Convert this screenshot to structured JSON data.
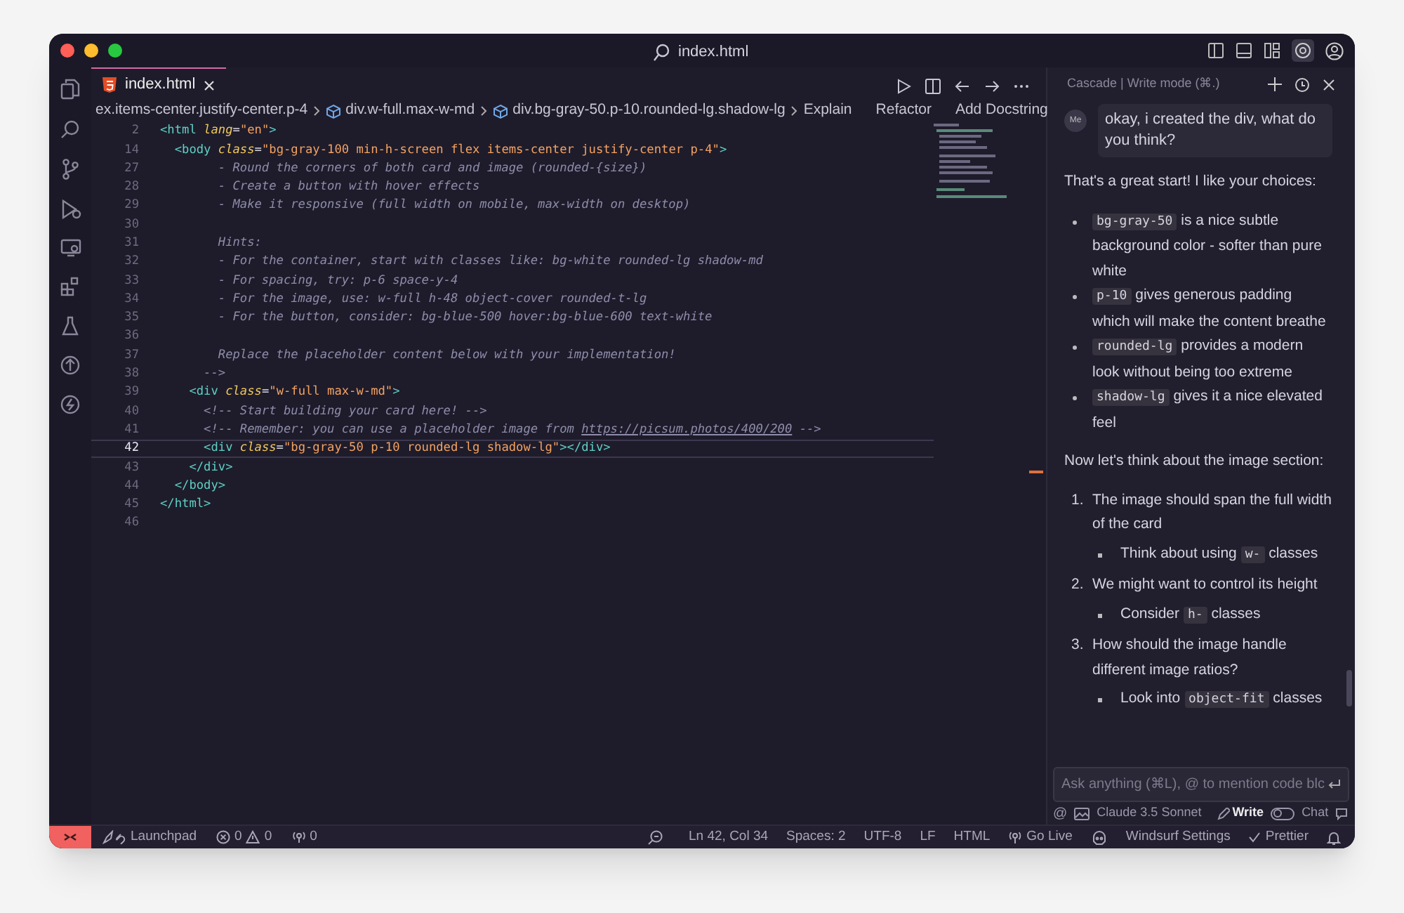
{
  "window": {
    "title": "index.html"
  },
  "activity_bar": [
    {
      "kind": "files",
      "selected": false
    },
    {
      "kind": "search",
      "selected": false
    },
    {
      "kind": "branch",
      "selected": false
    },
    {
      "kind": "run",
      "selected": false
    },
    {
      "kind": "remote",
      "selected": false
    },
    {
      "kind": "extensions",
      "selected": false
    },
    {
      "kind": "flask",
      "selected": false
    },
    {
      "kind": "deploy",
      "selected": false
    },
    {
      "kind": "bolt",
      "selected": false
    }
  ],
  "tabs": [
    {
      "label": "index.html",
      "selected": true
    }
  ],
  "breadcrumbs": [
    {
      "label": "ex.items-center.justify-center.p-4",
      "icon": false
    },
    {
      "label": "div.w-full.max-w-md",
      "icon": true
    },
    {
      "label": "div.bg-gray-50.p-10.rounded-lg.shadow-lg",
      "icon": true
    }
  ],
  "code_actions": [
    "Explain",
    "Refactor",
    "Add Docstring"
  ],
  "code_lines": [
    {
      "number": "2",
      "selected": false,
      "tokens": [
        {
          "kind": "tag",
          "text": "<html "
        },
        {
          "kind": "attr",
          "text": "lang"
        },
        {
          "kind": "punct",
          "text": "="
        },
        {
          "kind": "string",
          "text": "\"en\""
        },
        {
          "kind": "tag",
          "text": ">"
        }
      ]
    },
    {
      "number": "14",
      "selected": false,
      "tokens": [
        {
          "kind": "tag",
          "text": "  <body "
        },
        {
          "kind": "attr",
          "text": "class"
        },
        {
          "kind": "punct",
          "text": "="
        },
        {
          "kind": "string",
          "text": "\"bg-gray-100 min-h-screen flex items-center justify-center p-4\""
        },
        {
          "kind": "tag",
          "text": ">"
        }
      ]
    },
    {
      "number": "27",
      "selected": false,
      "tokens": [
        {
          "kind": "comment",
          "text": "        - Round the corners of both card and image (rounded-{size})"
        }
      ]
    },
    {
      "number": "28",
      "selected": false,
      "tokens": [
        {
          "kind": "comment",
          "text": "        - Create a button with hover effects"
        }
      ]
    },
    {
      "number": "29",
      "selected": false,
      "tokens": [
        {
          "kind": "comment",
          "text": "        - Make it responsive (full width on mobile, max-width on desktop)"
        }
      ]
    },
    {
      "number": "30",
      "selected": false
    },
    {
      "number": "31",
      "selected": false,
      "tokens": [
        {
          "kind": "comment",
          "text": "        Hints:"
        }
      ]
    },
    {
      "number": "32",
      "selected": false,
      "tokens": [
        {
          "kind": "comment",
          "text": "        - For the container, start with classes like: bg-white rounded-lg shadow-md"
        }
      ]
    },
    {
      "number": "33",
      "selected": false,
      "tokens": [
        {
          "kind": "comment",
          "text": "        - For spacing, try: p-6 space-y-4"
        }
      ]
    },
    {
      "number": "34",
      "selected": false,
      "tokens": [
        {
          "kind": "comment",
          "text": "        - For the image, use: w-full h-48 object-cover rounded-t-lg"
        }
      ]
    },
    {
      "number": "35",
      "selected": false,
      "tokens": [
        {
          "kind": "comment",
          "text": "        - For the button, consider: bg-blue-500 hover:bg-blue-600 text-white"
        }
      ]
    },
    {
      "number": "36",
      "selected": false
    },
    {
      "number": "37",
      "selected": false,
      "tokens": [
        {
          "kind": "comment",
          "text": "        Replace the placeholder content below with your implementation!"
        }
      ]
    },
    {
      "number": "38",
      "selected": false,
      "tokens": [
        {
          "kind": "comment",
          "text": "      -->"
        }
      ]
    },
    {
      "number": "39",
      "selected": false,
      "tokens": [
        {
          "kind": "tag",
          "text": "    <div "
        },
        {
          "kind": "attr",
          "text": "class"
        },
        {
          "kind": "punct",
          "text": "="
        },
        {
          "kind": "string",
          "text": "\"w-full max-w-md\""
        },
        {
          "kind": "tag",
          "text": ">"
        }
      ]
    },
    {
      "number": "40",
      "selected": false,
      "tokens": [
        {
          "kind": "comment",
          "text": "      <!-- Start building your card here! -->"
        }
      ]
    },
    {
      "number": "41",
      "selected": false,
      "tokens": [
        {
          "kind": "comment",
          "text": "      <!-- Remember: you can use a placeholder image from "
        },
        {
          "kind": "link",
          "text": "https://picsum.photos/400/200"
        },
        {
          "kind": "comment",
          "text": " -->"
        }
      ]
    },
    {
      "number": "42",
      "selected": true,
      "tokens": [
        {
          "kind": "tag",
          "text": "      <div "
        },
        {
          "kind": "attr",
          "text": "class"
        },
        {
          "kind": "punct",
          "text": "="
        },
        {
          "kind": "string",
          "text": "\"bg-gray-50 p-10 rounded-lg shadow-lg\""
        },
        {
          "kind": "tag",
          "text": "></div>"
        }
      ]
    },
    {
      "number": "43",
      "selected": false,
      "tokens": [
        {
          "kind": "tag",
          "text": "    </div>"
        }
      ]
    },
    {
      "number": "44",
      "selected": false,
      "tokens": [
        {
          "kind": "tag",
          "text": "  </body>"
        }
      ]
    },
    {
      "number": "45",
      "selected": false,
      "tokens": [
        {
          "kind": "tag",
          "text": "</html>"
        }
      ]
    },
    {
      "number": "46",
      "selected": false
    }
  ],
  "chat": {
    "header": "Cascade | Write mode (⌘.)",
    "user_avatar": "Me",
    "user_message": "okay, i created the div, what do you think?",
    "blocks": [
      {
        "kind": "paragraph",
        "parts": [
          {
            "kind": "text",
            "text": "That's a great start! I like your choices:"
          }
        ]
      },
      {
        "kind": "bullets",
        "items": [
          {
            "parts": [
              {
                "kind": "code",
                "text": "bg-gray-50"
              },
              {
                "kind": "text",
                "text": " is a nice subtle background color - softer than pure white"
              }
            ]
          },
          {
            "parts": [
              {
                "kind": "code",
                "text": "p-10"
              },
              {
                "kind": "text",
                "text": " gives generous padding which will make the content breathe"
              }
            ]
          },
          {
            "parts": [
              {
                "kind": "code",
                "text": "rounded-lg"
              },
              {
                "kind": "text",
                "text": " provides a modern look without being too extreme"
              }
            ]
          },
          {
            "parts": [
              {
                "kind": "code",
                "text": "shadow-lg"
              },
              {
                "kind": "text",
                "text": " gives it a nice elevated feel"
              }
            ]
          }
        ]
      },
      {
        "kind": "paragraph",
        "parts": [
          {
            "kind": "text",
            "text": "Now let's think about the image section:"
          }
        ]
      },
      {
        "kind": "numbered",
        "items": [
          {
            "marker": "1.",
            "parts": [
              {
                "kind": "text",
                "text": "The image should span the full width of the card"
              }
            ],
            "sub": [
              {
                "parts": [
                  {
                    "kind": "text",
                    "text": "Think about using "
                  },
                  {
                    "kind": "code",
                    "text": "w-"
                  },
                  {
                    "kind": "text",
                    "text": " classes"
                  }
                ]
              }
            ]
          },
          {
            "marker": "2.",
            "parts": [
              {
                "kind": "text",
                "text": "We might want to control its height"
              }
            ],
            "sub": [
              {
                "parts": [
                  {
                    "kind": "text",
                    "text": "Consider "
                  },
                  {
                    "kind": "code",
                    "text": "h-"
                  },
                  {
                    "kind": "text",
                    "text": " classes"
                  }
                ]
              }
            ]
          },
          {
            "marker": "3.",
            "parts": [
              {
                "kind": "text",
                "text": "How should the image handle different image ratios?"
              }
            ],
            "sub": [
              {
                "parts": [
                  {
                    "kind": "text",
                    "text": "Look into "
                  },
                  {
                    "kind": "code",
                    "text": "object-fit"
                  },
                  {
                    "kind": "text",
                    "text": " classes"
                  }
                ]
              }
            ]
          }
        ]
      }
    ],
    "input_placeholder": "Ask anything (⌘L), @ to mention code blc",
    "mention": "@",
    "model": "Claude 3.5 Sonnet",
    "mode_write": "Write",
    "mode_chat": "Chat",
    "write_mode_on": false
  },
  "status_bar": {
    "left": [
      {
        "kind": "launchpad",
        "text": "Launchpad"
      },
      {
        "kind": "problems",
        "errors": "0",
        "warnings": "0"
      },
      {
        "kind": "ports",
        "text": "0"
      }
    ],
    "right": [
      {
        "kind": "zoom"
      },
      {
        "kind": "text",
        "text": "Ln 42, Col 34"
      },
      {
        "kind": "text",
        "text": "Spaces: 2"
      },
      {
        "kind": "text",
        "text": "UTF-8"
      },
      {
        "kind": "text",
        "text": "LF"
      },
      {
        "kind": "text",
        "text": "HTML"
      },
      {
        "kind": "golive",
        "text": "Go Live"
      },
      {
        "kind": "copilot"
      },
      {
        "kind": "text",
        "text": "Windsurf Settings"
      },
      {
        "kind": "check",
        "text": "Prettier"
      },
      {
        "kind": "bell"
      }
    ]
  }
}
